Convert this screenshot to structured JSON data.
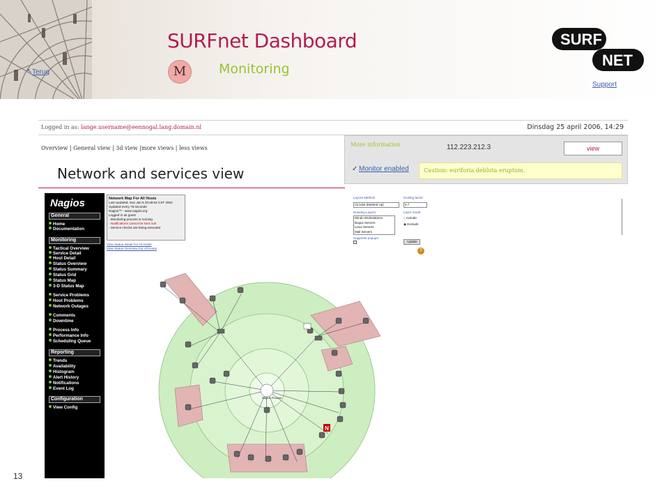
{
  "header": {
    "back_link": "Terug",
    "title": "SURFnet Dashboard",
    "section_letter": "M",
    "subtitle": "Monitoring",
    "logo_top": "SURF",
    "logo_bottom": "NET",
    "support_link": "Support"
  },
  "info_bar": {
    "logged_in_label": "Logged in as:",
    "logged_in_user": "lange.username@eennogal.lang.domain.nl",
    "datetime": "Dinsdag 25 april 2006, 14:29"
  },
  "view_nav": [
    "Overview",
    "General view",
    "3d view",
    "more views",
    "less views"
  ],
  "page_heading": "Network and services view",
  "panel": {
    "more_info": "More information",
    "ip": "112.223.212.3",
    "view_button": "view",
    "monitor_enabled": "Monitor enabled",
    "caution": "Caution: euriforia debluta eruptum."
  },
  "nagios": {
    "logo": "Nagios",
    "sections": [
      {
        "title": "General",
        "items": [
          "Home",
          "Documentation"
        ]
      },
      {
        "title": "Monitoring",
        "items": [
          "Tactical Overview",
          "Service Detail",
          "Host Detail",
          "Status Overview",
          "Status Summary",
          "Status Grid",
          "Status Map",
          "3-D Status Map",
          "Service Problems",
          "Host Problems",
          "Network Outages",
          "Comments",
          "Downtime",
          "Process Info",
          "Performance Info",
          "Scheduling Queue"
        ]
      },
      {
        "title": "Reporting",
        "items": [
          "Trends",
          "Availability",
          "Histogram",
          "Alert History",
          "Notifications",
          "Event Log"
        ]
      },
      {
        "title": "Configuration",
        "items": [
          "View Config"
        ]
      }
    ]
  },
  "map_info": {
    "title": "Network Map For All Hosts",
    "updated": "Last Updated: Sun Jan 6 20:28:54 CST 2002",
    "interval": "Updated every 75 seconds",
    "nagios_link": "Nagios™ - www.nagios.org",
    "logged_as": "Logged in as guest",
    "line1": "- Monitoring process is running",
    "line2": "- Notifications cannot be sent out!",
    "line3": "- Service checks are being executed",
    "link1": "View Status Detail For All Hosts",
    "link2": "View Status Overview For All Hosts"
  },
  "layout_form": {
    "layout_method_label": "Layout Method:",
    "layout_method_value": "Circular (Marked Up)",
    "scaling_label": "Scaling factor:",
    "scaling_value": "0.7",
    "drawing_layers_label": "Drawing Layers:",
    "layers": [
      "Windo Workstations",
      "Bogus Servers",
      "Linux Servers",
      "Mail Servers"
    ],
    "layer_mode_label": "Layer mode:",
    "include": "Include",
    "exclude": "Exclude",
    "suppress_label": "Suppress popups:",
    "update_button": "Update"
  },
  "page_number": "13",
  "colors": {
    "brand": "#b21d51",
    "accent_green": "#9ac430",
    "link": "#3a5fb0",
    "map_green": "#cdeec0",
    "map_red": "#e2b4b4"
  }
}
